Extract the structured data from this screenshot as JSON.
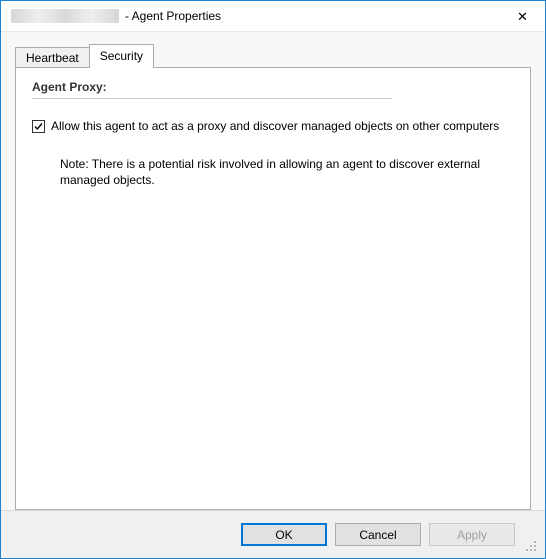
{
  "window": {
    "title_suffix": " - Agent Properties"
  },
  "tabs": {
    "heartbeat": "Heartbeat",
    "security": "Security",
    "active": "security"
  },
  "section": {
    "header": "Agent Proxy:"
  },
  "checkbox": {
    "checked": true,
    "label": "Allow this agent to act as a proxy and discover managed objects on other computers"
  },
  "note": {
    "text": "Note: There is a potential risk involved in allowing an agent to discover external managed objects."
  },
  "buttons": {
    "ok": "OK",
    "cancel": "Cancel",
    "apply": "Apply"
  }
}
